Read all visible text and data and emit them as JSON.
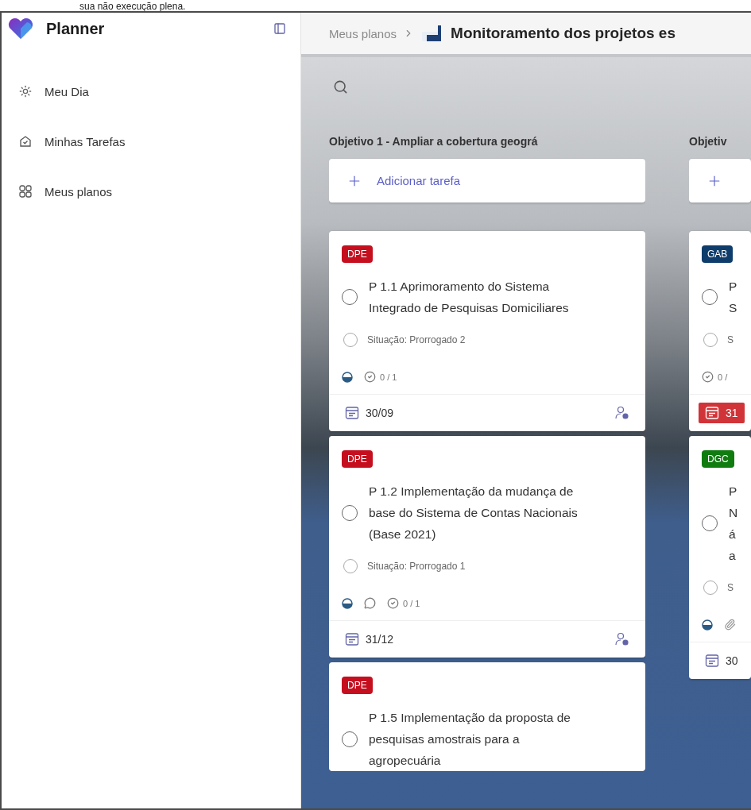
{
  "caption": "sua não execução plena.",
  "sidebar": {
    "app_name": "Planner",
    "items": [
      {
        "label": "Meu Dia",
        "selected": false
      },
      {
        "label": "Minhas Tarefas",
        "selected": false
      },
      {
        "label": "Meus planos",
        "selected": false
      }
    ]
  },
  "header": {
    "breadcrumb": "Meus planos",
    "plan_title": "Monitoramento dos projetos es"
  },
  "columns": [
    {
      "title": "Objetivo 1 - Ampliar a cobertura geográ",
      "add_task": "Adicionar tarefa",
      "cards": [
        {
          "tag": {
            "label": "DPE",
            "color": "#c50f1f"
          },
          "completed": false,
          "title_lines": [
            "P 1.1 Aprimoramento do Sistema",
            "Integrado de Pesquisas Domiciliares"
          ],
          "status": "Situação: Prorrogado 2",
          "status_checked": false,
          "meta": [
            {
              "kind": "progress"
            },
            {
              "kind": "checklist",
              "text": "0 / 1"
            }
          ],
          "due": {
            "date": "30/09",
            "overdue": false
          }
        },
        {
          "tag": {
            "label": "DPE",
            "color": "#c50f1f"
          },
          "completed": false,
          "title_lines": [
            "P 1.2 Implementação da mudança de",
            "base do Sistema de Contas Nacionais",
            "(Base 2021)"
          ],
          "status": "Situação: Prorrogado 1",
          "status_checked": false,
          "meta": [
            {
              "kind": "progress"
            },
            {
              "kind": "comment"
            },
            {
              "kind": "checklist",
              "text": "0 / 1"
            }
          ],
          "due": {
            "date": "31/12",
            "overdue": false
          }
        },
        {
          "tag": {
            "label": "DPE",
            "color": "#c50f1f"
          },
          "completed": false,
          "title_lines": [
            "P 1.5 Implementação da proposta de",
            "pesquisas amostrais para a",
            "agropecuária"
          ]
        }
      ]
    },
    {
      "title": "Objetiv",
      "cards": [
        {
          "tag": {
            "label": "GAB",
            "color": "#0f3d6b"
          },
          "completed": false,
          "title_lines": [
            "P",
            "S"
          ],
          "status": "S",
          "status_checked": false,
          "meta": [
            {
              "kind": "checklist",
              "text": "0 /"
            }
          ],
          "due": {
            "date": "31",
            "overdue": true
          }
        },
        {
          "tag": {
            "label": "DGC",
            "color": "#107c10"
          },
          "completed": false,
          "title_lines": [
            "P",
            "N",
            "á",
            "a"
          ],
          "status": "S",
          "status_checked": false,
          "meta": [
            {
              "kind": "progress"
            },
            {
              "kind": "attachment"
            }
          ],
          "due": {
            "date": "30",
            "overdue": false
          }
        }
      ]
    }
  ]
}
